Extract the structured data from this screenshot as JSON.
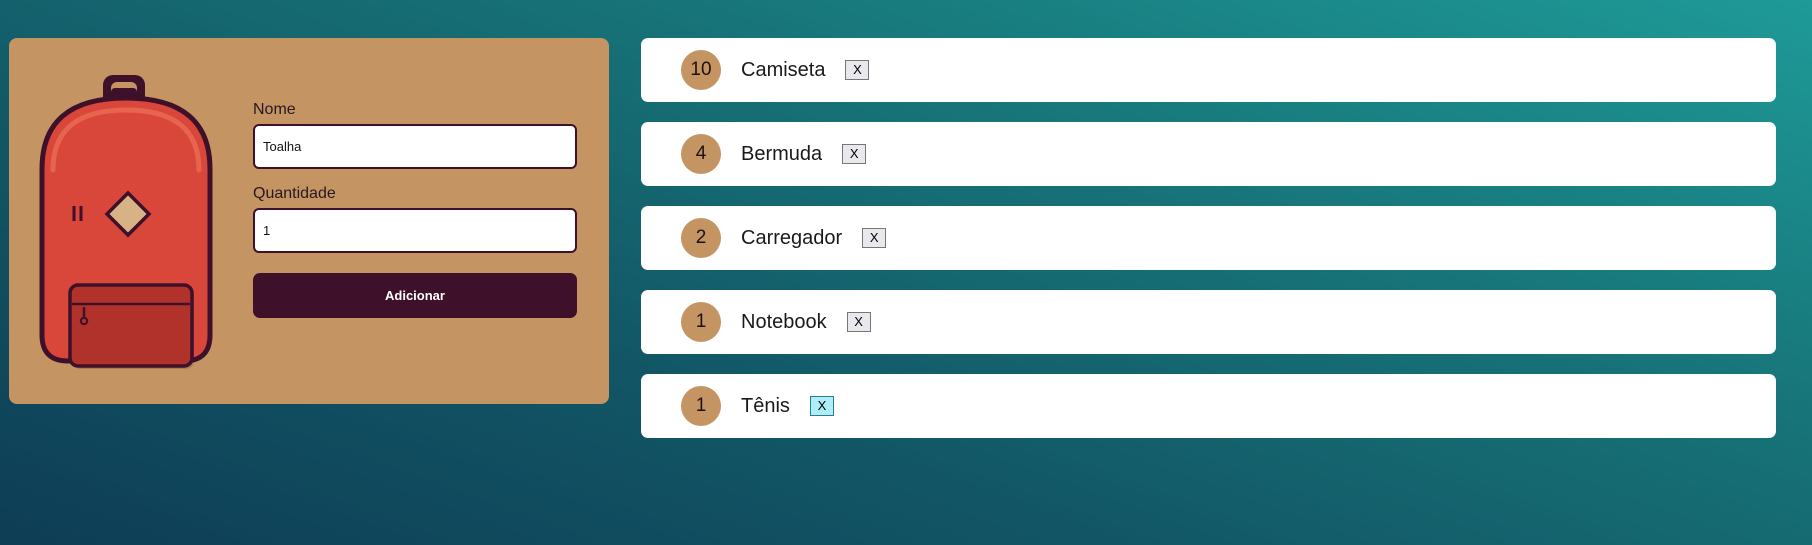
{
  "form": {
    "name_label": "Nome",
    "name_value": "Toalha",
    "quantity_label": "Quantidade",
    "quantity_value": "1",
    "submit_label": "Adicionar"
  },
  "items": [
    {
      "quantity": "10",
      "name": "Camiseta",
      "remove_label": "X"
    },
    {
      "quantity": "4",
      "name": "Bermuda",
      "remove_label": "X"
    },
    {
      "quantity": "2",
      "name": "Carregador",
      "remove_label": "X"
    },
    {
      "quantity": "1",
      "name": "Notebook",
      "remove_label": "X"
    },
    {
      "quantity": "1",
      "name": "Tênis",
      "remove_label": "X",
      "hovered": true
    }
  ],
  "colors": {
    "panel": "#c49562",
    "accent": "#3e1029",
    "backpack_body": "#d9473a",
    "hover_button": "#aeeef8"
  },
  "icons": {
    "logo": "backpack-icon"
  }
}
